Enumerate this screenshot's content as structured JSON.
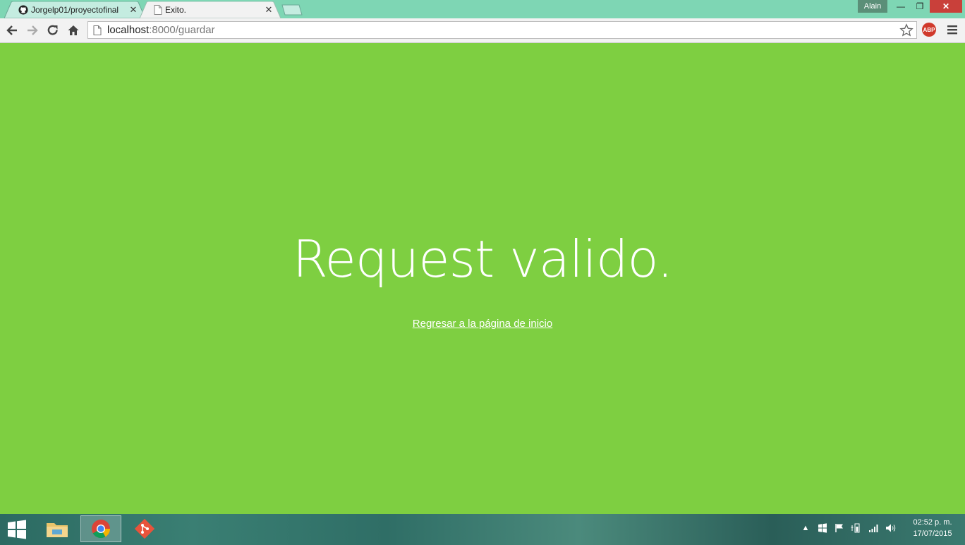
{
  "browser": {
    "tabs": [
      {
        "title": "Jorgelp01/proyectofinal",
        "icon": "github-icon",
        "active": false
      },
      {
        "title": "Exito.",
        "icon": "page-icon",
        "active": true
      }
    ],
    "user": "Alain",
    "url_host": "localhost",
    "url_path": ":8000/guardar",
    "extension": "ABP"
  },
  "page": {
    "headline": "Request valido.",
    "link_text": "Regresar a la página de inicio",
    "background": "#7ecf41"
  },
  "taskbar": {
    "apps": [
      "file-explorer-icon",
      "chrome-icon",
      "git-icon"
    ],
    "time": "02:52 p. m.",
    "date": "17/07/2015"
  }
}
